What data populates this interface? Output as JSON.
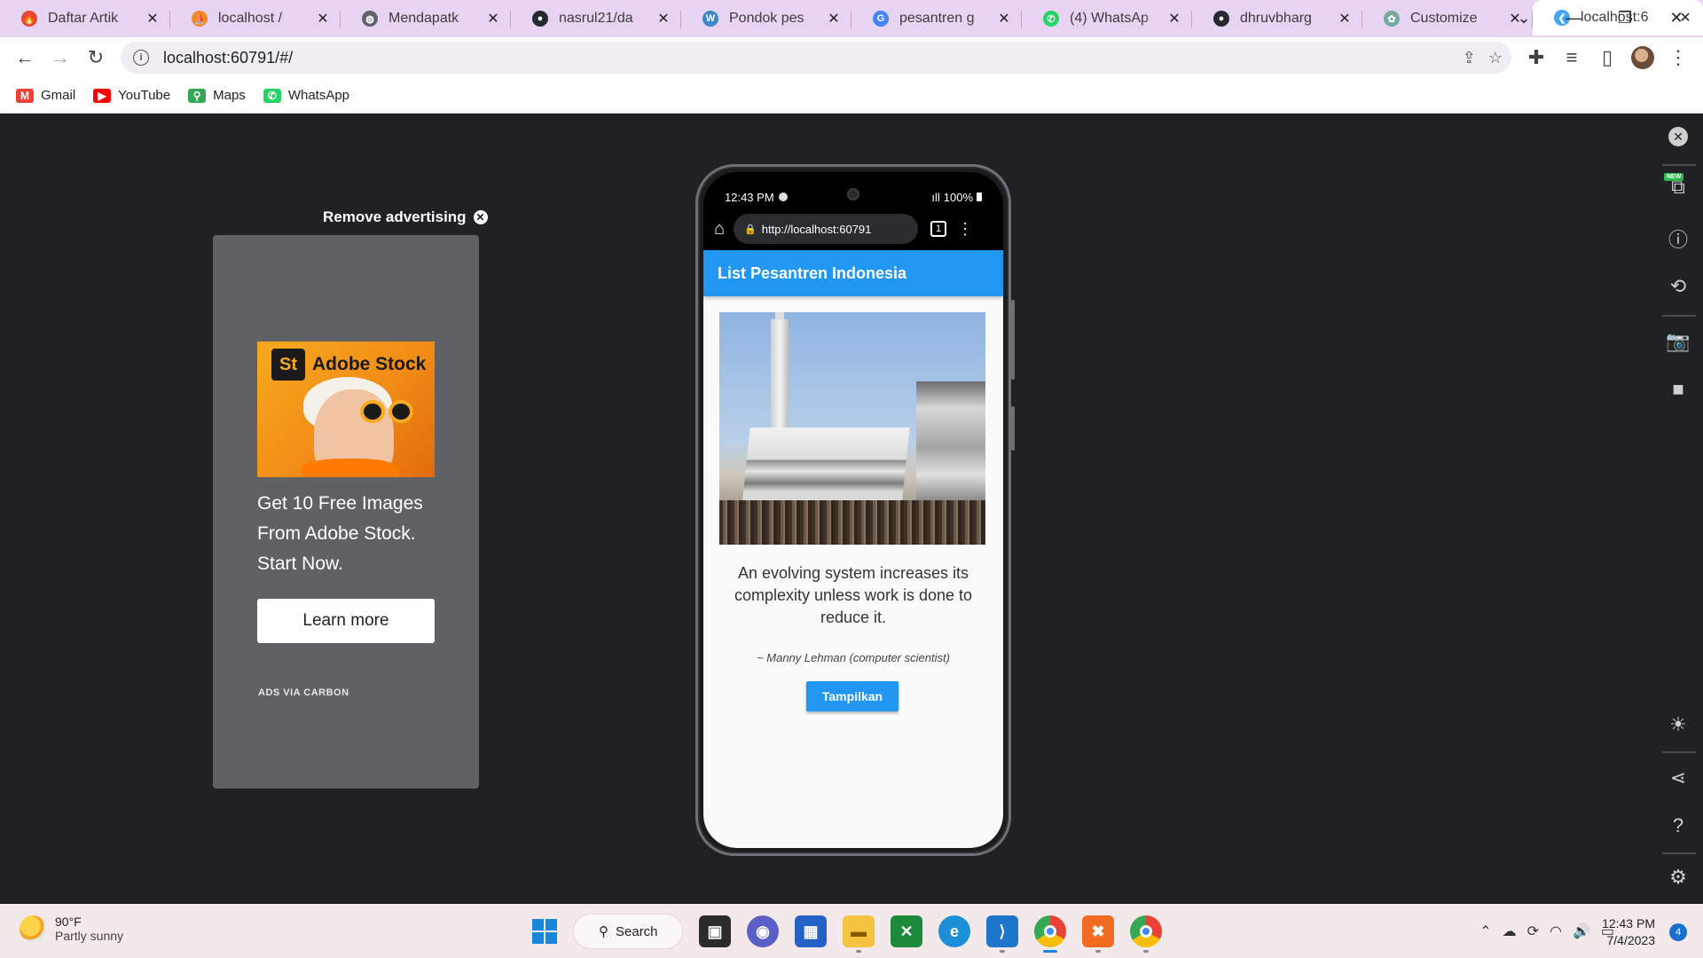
{
  "tabs": [
    {
      "title": "Daftar Artik",
      "icon": "fire-icon",
      "color": "#e8453c",
      "glyph": "🔥"
    },
    {
      "title": "localhost /",
      "icon": "phpmyadmin-icon",
      "color": "#f08a24",
      "glyph": "⛵"
    },
    {
      "title": "Mendapatk",
      "icon": "globe-icon",
      "color": "#5f6368",
      "glyph": "◍"
    },
    {
      "title": "nasrul21/da",
      "icon": "github-icon",
      "color": "#24292f",
      "glyph": "●"
    },
    {
      "title": "Pondok pes",
      "icon": "wordpress-icon",
      "color": "#3b87c8",
      "glyph": "W"
    },
    {
      "title": "pesantren g",
      "icon": "google-icon",
      "color": "#4285f4",
      "glyph": "G"
    },
    {
      "title": "(4) WhatsAp",
      "icon": "whatsapp-icon",
      "color": "#25d366",
      "glyph": "✆"
    },
    {
      "title": "dhruvbharg",
      "icon": "github-icon",
      "color": "#24292f",
      "glyph": "●"
    },
    {
      "title": "Customize",
      "icon": "chatgpt-icon",
      "color": "#74aa9c",
      "glyph": "✿"
    },
    {
      "title": "localhost:6",
      "icon": "flutter-icon",
      "color": "#42a5f5",
      "glyph": "❮"
    }
  ],
  "toolbar": {
    "url": "localhost:60791/#/"
  },
  "bookmarks": [
    {
      "label": "Gmail",
      "icon": "gmail-icon",
      "color": "#ea4335",
      "glyph": "M"
    },
    {
      "label": "YouTube",
      "icon": "youtube-icon",
      "color": "#ff0000",
      "glyph": "▶"
    },
    {
      "label": "Maps",
      "icon": "maps-icon",
      "color": "#34a853",
      "glyph": "⚲"
    },
    {
      "label": "WhatsApp",
      "icon": "whatsapp-icon",
      "color": "#25d366",
      "glyph": "✆"
    }
  ],
  "ad": {
    "remove_label": "Remove advertising",
    "brand_short": "St",
    "brand": "Adobe Stock",
    "text": "Get 10 Free Images From Adobe Stock. Start Now.",
    "button": "Learn more",
    "via": "ADS VIA CARBON"
  },
  "phone": {
    "time": "12:43 PM",
    "battery": "100%",
    "url": "http://localhost:60791",
    "tab_count": "1",
    "app": {
      "title": "List Pesantren Indonesia",
      "quote": "An evolving system increases its complexity unless work is done to reduce it.",
      "author": "~ Manny Lehman (computer scientist)",
      "button": "Tampilkan"
    }
  },
  "taskbar": {
    "temp": "90°F",
    "weather": "Partly sunny",
    "search": "Search",
    "time": "12:43 PM",
    "date": "7/4/2023",
    "notifications": "4"
  },
  "colors": {
    "accent": "#2196f3",
    "page_bg": "#202124",
    "tabstrip_bg": "#e7d4f3"
  }
}
